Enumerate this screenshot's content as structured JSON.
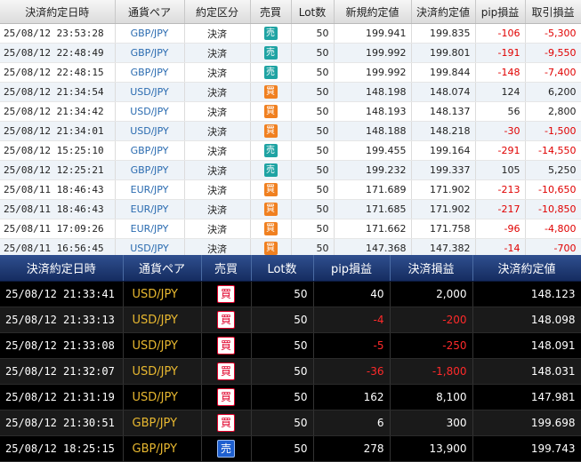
{
  "top_table": {
    "headers": [
      "決済約定日時",
      "通貨ペア",
      "約定区分",
      "売買",
      "Lot数",
      "新規約定値",
      "決済約定値",
      "pip損益",
      "取引損益"
    ],
    "rows": [
      {
        "datetime": "25/08/12 23:53:28",
        "pair": "GBP/JPY",
        "kind": "決済",
        "side": "売",
        "side_type": "sell",
        "lot": "50",
        "open": "199.941",
        "close": "199.835",
        "pip": "-106",
        "pnl": "-5,300",
        "neg": true
      },
      {
        "datetime": "25/08/12 22:48:49",
        "pair": "GBP/JPY",
        "kind": "決済",
        "side": "売",
        "side_type": "sell",
        "lot": "50",
        "open": "199.992",
        "close": "199.801",
        "pip": "-191",
        "pnl": "-9,550",
        "neg": true
      },
      {
        "datetime": "25/08/12 22:48:15",
        "pair": "GBP/JPY",
        "kind": "決済",
        "side": "売",
        "side_type": "sell",
        "lot": "50",
        "open": "199.992",
        "close": "199.844",
        "pip": "-148",
        "pnl": "-7,400",
        "neg": true
      },
      {
        "datetime": "25/08/12 21:34:54",
        "pair": "USD/JPY",
        "kind": "決済",
        "side": "買",
        "side_type": "buy",
        "lot": "50",
        "open": "148.198",
        "close": "148.074",
        "pip": "124",
        "pnl": "6,200",
        "neg": false
      },
      {
        "datetime": "25/08/12 21:34:42",
        "pair": "USD/JPY",
        "kind": "決済",
        "side": "買",
        "side_type": "buy",
        "lot": "50",
        "open": "148.193",
        "close": "148.137",
        "pip": "56",
        "pnl": "2,800",
        "neg": false
      },
      {
        "datetime": "25/08/12 21:34:01",
        "pair": "USD/JPY",
        "kind": "決済",
        "side": "買",
        "side_type": "buy",
        "lot": "50",
        "open": "148.188",
        "close": "148.218",
        "pip": "-30",
        "pnl": "-1,500",
        "neg": true
      },
      {
        "datetime": "25/08/12 15:25:10",
        "pair": "GBP/JPY",
        "kind": "決済",
        "side": "売",
        "side_type": "sell",
        "lot": "50",
        "open": "199.455",
        "close": "199.164",
        "pip": "-291",
        "pnl": "-14,550",
        "neg": true
      },
      {
        "datetime": "25/08/12 12:25:21",
        "pair": "GBP/JPY",
        "kind": "決済",
        "side": "売",
        "side_type": "sell",
        "lot": "50",
        "open": "199.232",
        "close": "199.337",
        "pip": "105",
        "pnl": "5,250",
        "neg": false
      },
      {
        "datetime": "25/08/11 18:46:43",
        "pair": "EUR/JPY",
        "kind": "決済",
        "side": "買",
        "side_type": "buy",
        "lot": "50",
        "open": "171.689",
        "close": "171.902",
        "pip": "-213",
        "pnl": "-10,650",
        "neg": true
      },
      {
        "datetime": "25/08/11 18:46:43",
        "pair": "EUR/JPY",
        "kind": "決済",
        "side": "買",
        "side_type": "buy",
        "lot": "50",
        "open": "171.685",
        "close": "171.902",
        "pip": "-217",
        "pnl": "-10,850",
        "neg": true
      },
      {
        "datetime": "25/08/11 17:09:26",
        "pair": "EUR/JPY",
        "kind": "決済",
        "side": "買",
        "side_type": "buy",
        "lot": "50",
        "open": "171.662",
        "close": "171.758",
        "pip": "-96",
        "pnl": "-4,800",
        "neg": true
      },
      {
        "datetime": "25/08/11 16:56:45",
        "pair": "USD/JPY",
        "kind": "決済",
        "side": "買",
        "side_type": "buy",
        "lot": "50",
        "open": "147.368",
        "close": "147.382",
        "pip": "-14",
        "pnl": "-700",
        "neg": true
      }
    ]
  },
  "bottom_table": {
    "headers": [
      "決済約定日時",
      "通貨ペア",
      "売買",
      "Lot数",
      "pip損益",
      "決済損益",
      "決済約定値"
    ],
    "rows": [
      {
        "datetime": "25/08/12 21:33:41",
        "pair": "USD/JPY",
        "side": "買",
        "side_type": "buy",
        "lot": "50",
        "pip": "40",
        "pnl": "2,000",
        "close": "148.123",
        "neg": false
      },
      {
        "datetime": "25/08/12 21:33:13",
        "pair": "USD/JPY",
        "side": "買",
        "side_type": "buy",
        "lot": "50",
        "pip": "-4",
        "pnl": "-200",
        "close": "148.098",
        "neg": true
      },
      {
        "datetime": "25/08/12 21:33:08",
        "pair": "USD/JPY",
        "side": "買",
        "side_type": "buy",
        "lot": "50",
        "pip": "-5",
        "pnl": "-250",
        "close": "148.091",
        "neg": true
      },
      {
        "datetime": "25/08/12 21:32:07",
        "pair": "USD/JPY",
        "side": "買",
        "side_type": "buy",
        "lot": "50",
        "pip": "-36",
        "pnl": "-1,800",
        "close": "148.031",
        "neg": true
      },
      {
        "datetime": "25/08/12 21:31:19",
        "pair": "USD/JPY",
        "side": "買",
        "side_type": "buy",
        "lot": "50",
        "pip": "162",
        "pnl": "8,100",
        "close": "147.981",
        "neg": false
      },
      {
        "datetime": "25/08/12 21:30:51",
        "pair": "GBP/JPY",
        "side": "買",
        "side_type": "buy",
        "lot": "50",
        "pip": "6",
        "pnl": "300",
        "close": "199.698",
        "neg": false
      },
      {
        "datetime": "25/08/12 18:25:15",
        "pair": "GBP/JPY",
        "side": "売",
        "side_type": "sell",
        "lot": "50",
        "pip": "278",
        "pnl": "13,900",
        "close": "199.743",
        "neg": false
      }
    ]
  },
  "colors": {
    "light_sell_badge": "#1fa3a3",
    "light_buy_badge": "#f08020",
    "dark_header": "#1f3c7a",
    "dark_pair": "#e8b830",
    "negative": "#e00000"
  }
}
